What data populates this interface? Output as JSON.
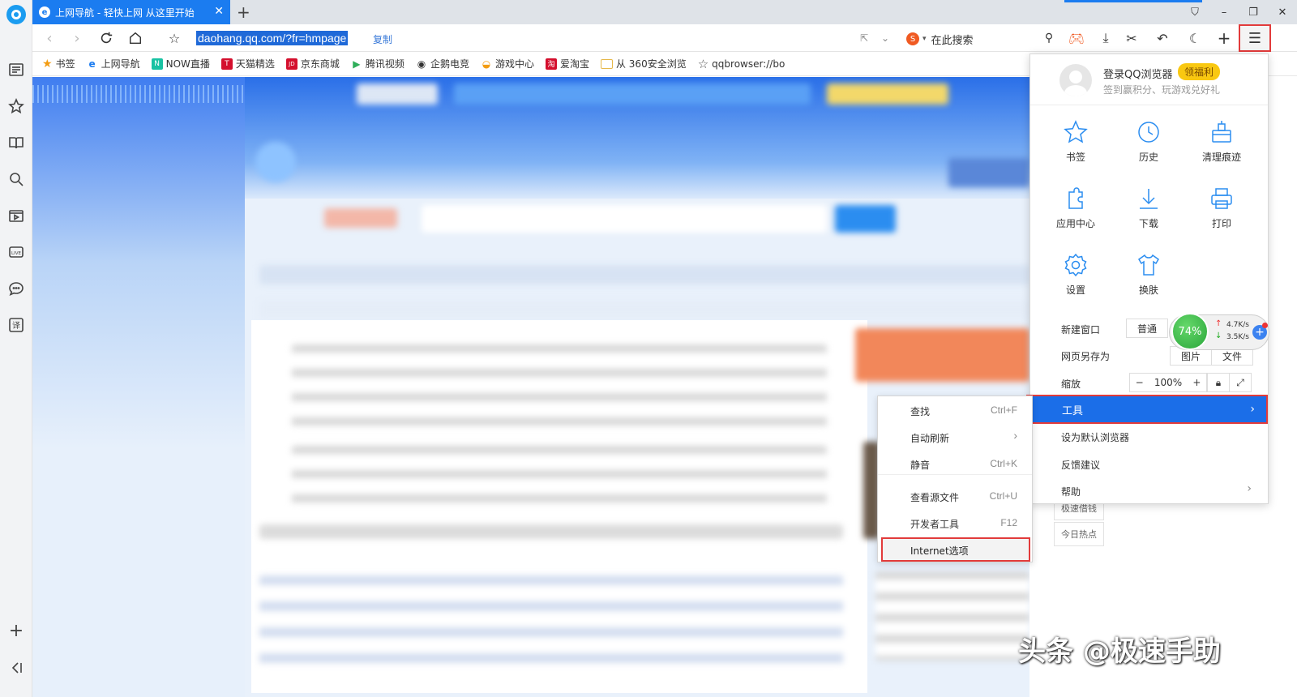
{
  "tab": {
    "title": "上网导航 - 轻快上网 从这里开始",
    "close": "✕",
    "new": "+"
  },
  "window": {
    "pin": "⛉",
    "min": "–",
    "max": "❐",
    "close": "✕"
  },
  "address": {
    "url": "daohang.qq.com/?fr=hmpage",
    "copy_label": "复制",
    "search_placeholder": "在此搜索",
    "search_engine_icon": "S"
  },
  "bookmarks": [
    {
      "label": "书签",
      "icon": "star-icon",
      "color": "#f39c12"
    },
    {
      "label": "上网导航",
      "icon": "e",
      "color": "#1b7cf0"
    },
    {
      "label": "NOW直播",
      "icon": "N",
      "color": "#19c2a3"
    },
    {
      "label": "天猫精选",
      "icon": "T",
      "color": "#d40f2d"
    },
    {
      "label": "京东商城",
      "icon": "JD",
      "color": "#d40f2d"
    },
    {
      "label": "腾讯视频",
      "icon": "▶",
      "color": "#2fae5a"
    },
    {
      "label": "企鹅电竞",
      "icon": "◉",
      "color": "#333333"
    },
    {
      "label": "游戏中心",
      "icon": "◒",
      "color": "#f39c12"
    },
    {
      "label": "爱淘宝",
      "icon": "淘",
      "color": "#d40f2d"
    },
    {
      "label": "从 360安全浏览",
      "icon": "folder-icon",
      "color": "#e6b84a"
    },
    {
      "label": "qqbrowser://bo",
      "icon": "star-outline-icon",
      "color": "#555555"
    }
  ],
  "menu": {
    "login": "登录QQ浏览器",
    "welfare": "领福利",
    "login_sub": "签到赢积分、玩游戏兑好礼",
    "grid": [
      {
        "label": "书签",
        "icon": "star-icon"
      },
      {
        "label": "历史",
        "icon": "clock-icon"
      },
      {
        "label": "清理痕迹",
        "icon": "broom-icon"
      },
      {
        "label": "应用中心",
        "icon": "puzzle-icon"
      },
      {
        "label": "下载",
        "icon": "download-icon"
      },
      {
        "label": "打印",
        "icon": "printer-icon"
      },
      {
        "label": "设置",
        "icon": "gear-icon"
      },
      {
        "label": "换肤",
        "icon": "shirt-icon"
      }
    ],
    "new_window": "新建窗口",
    "new_window_normal": "普通",
    "save_as": "网页另存为",
    "save_image": "图片",
    "save_file": "文件",
    "zoom": "缩放",
    "zoom_minus": "−",
    "zoom_value": "100%",
    "zoom_plus": "+",
    "tools": "工具",
    "set_default": "设为默认浏览器",
    "feedback": "反馈建议",
    "help": "帮助"
  },
  "speed": {
    "percent": "74%",
    "up": "4.7K/s",
    "down": "3.5K/s"
  },
  "submenu": [
    {
      "label": "查找",
      "shortcut": "Ctrl+F"
    },
    {
      "label": "自动刷新",
      "shortcut": "›"
    },
    {
      "label": "静音",
      "shortcut": "Ctrl+K"
    },
    {
      "label": "查看源文件",
      "shortcut": "Ctrl+U"
    },
    {
      "label": "开发者工具",
      "shortcut": "F12"
    },
    {
      "label": "Internet选项",
      "shortcut": ""
    }
  ],
  "right_side": [
    "极速借钱",
    "今日热点"
  ],
  "watermark": "头条 @极速手助"
}
